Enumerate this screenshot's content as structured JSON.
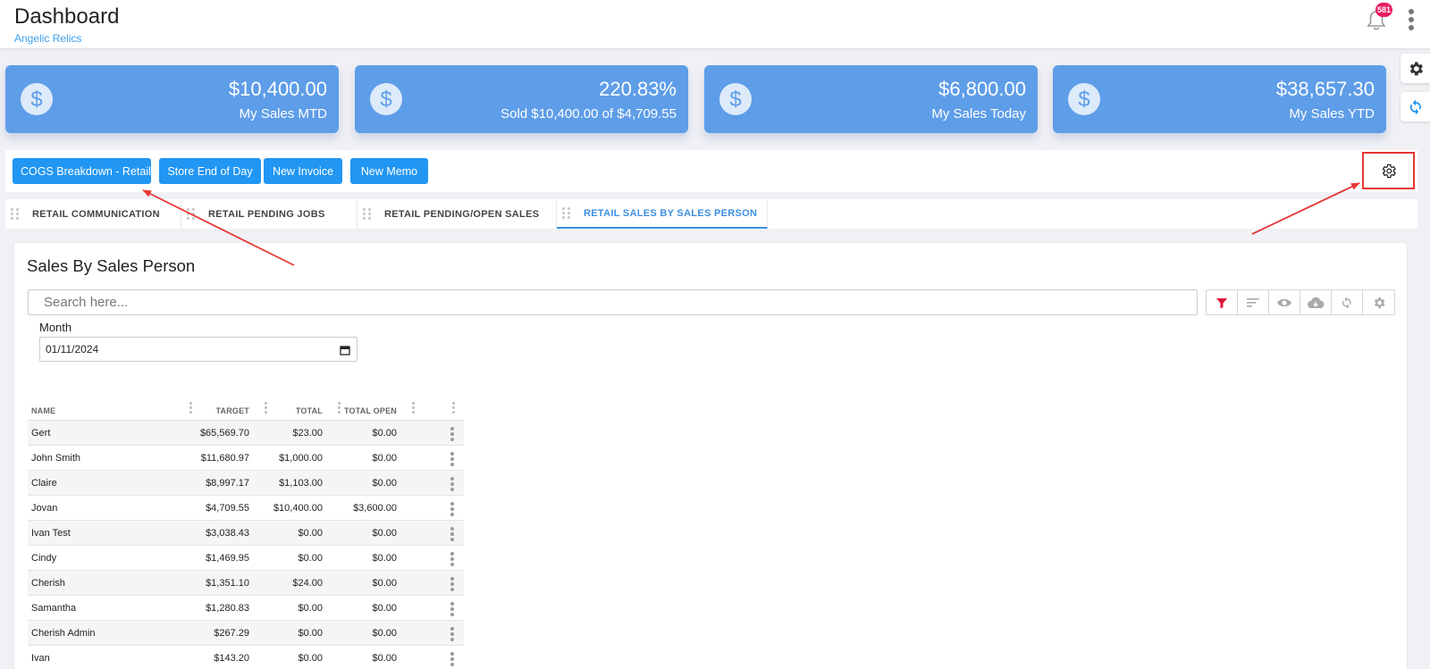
{
  "header": {
    "title": "Dashboard",
    "subtitle": "Angelic Relics",
    "notification_count": "581"
  },
  "cards": [
    {
      "value": "$10,400.00",
      "label": "My Sales MTD"
    },
    {
      "value": "220.83%",
      "label": "Sold $10,400.00 of $4,709.55"
    },
    {
      "value": "$6,800.00",
      "label": "My Sales Today"
    },
    {
      "value": "$38,657.30",
      "label": "My Sales YTD"
    }
  ],
  "toolbar": {
    "buttons": [
      "COGS Breakdown - Retail",
      "Store End of Day",
      "New Invoice",
      "New Memo"
    ]
  },
  "tabs": [
    "RETAIL COMMUNICATION",
    "RETAIL PENDING JOBS",
    "RETAIL PENDING/OPEN SALES",
    "RETAIL SALES BY SALES PERSON"
  ],
  "panel": {
    "title": "Sales By Sales Person",
    "search_placeholder": "Search here...",
    "month_label": "Month",
    "month_value": "01/11/2024"
  },
  "table": {
    "columns": [
      "NAME",
      "TARGET",
      "TOTAL",
      "TOTAL OPEN"
    ],
    "rows": [
      [
        "Gert",
        "$65,569.70",
        "$23.00",
        "$0.00"
      ],
      [
        "John Smith",
        "$11,680.97",
        "$1,000.00",
        "$0.00"
      ],
      [
        "Claire",
        "$8,997.17",
        "$1,103.00",
        "$0.00"
      ],
      [
        "Jovan",
        "$4,709.55",
        "$10,400.00",
        "$3,600.00"
      ],
      [
        "Ivan Test",
        "$3,038.43",
        "$0.00",
        "$0.00"
      ],
      [
        "Cindy",
        "$1,469.95",
        "$0.00",
        "$0.00"
      ],
      [
        "Cherish",
        "$1,351.10",
        "$24.00",
        "$0.00"
      ],
      [
        "Samantha",
        "$1,280.83",
        "$0.00",
        "$0.00"
      ],
      [
        "Cherish Admin",
        "$267.29",
        "$0.00",
        "$0.00"
      ],
      [
        "Ivan",
        "$143.20",
        "$0.00",
        "$0.00"
      ]
    ]
  },
  "colors": {
    "card_bg": "#5e9de8",
    "button_bg": "#2196f3",
    "active_tab": "#3d8fe0",
    "badge": "#e91e63",
    "annotation": "#e53935",
    "filter_icon": "#e0163a"
  }
}
